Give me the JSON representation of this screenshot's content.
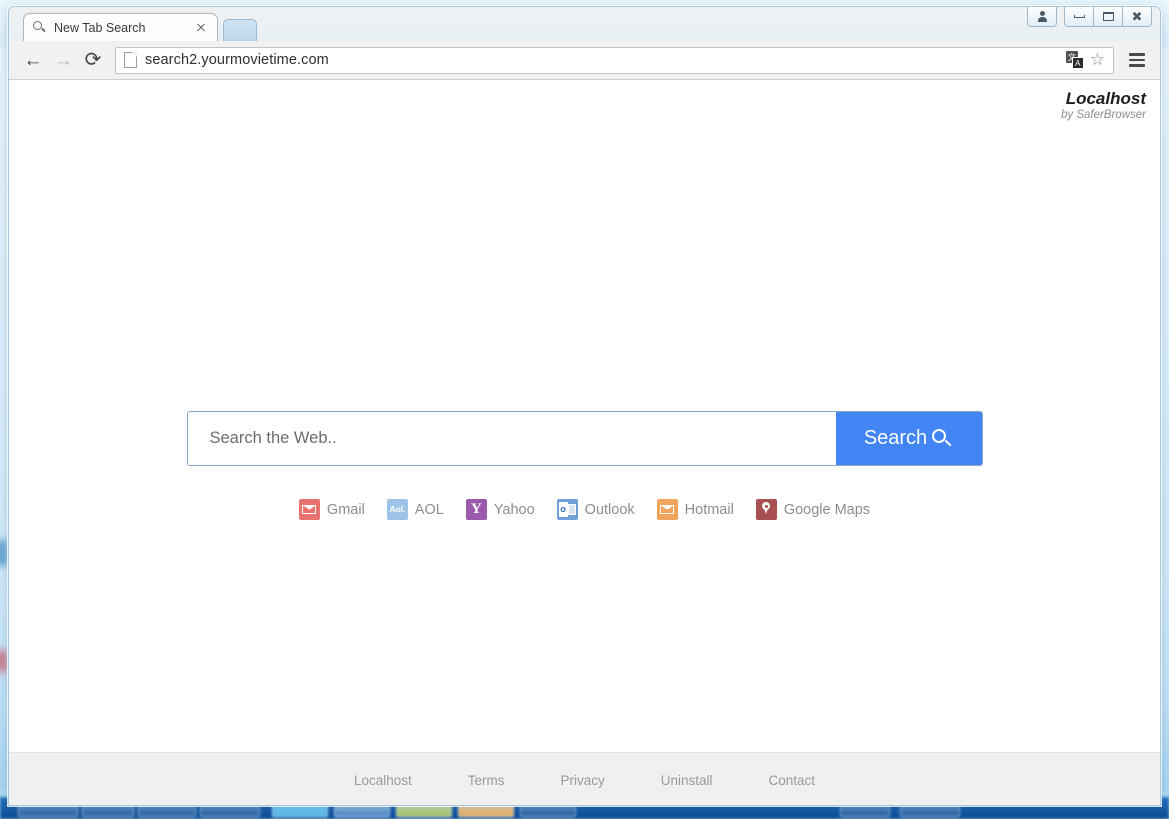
{
  "window": {
    "controls": [
      {
        "name": "user-switch",
        "glyph": "♟"
      },
      {
        "name": "minimize",
        "glyph": ""
      },
      {
        "name": "maximize",
        "glyph": ""
      },
      {
        "name": "close",
        "glyph": "✕"
      }
    ]
  },
  "tab": {
    "title": "New Tab Search",
    "favicon": "search-icon",
    "close_glyph": "×"
  },
  "toolbar": {
    "back_glyph": "←",
    "forward_glyph": "→",
    "reload_glyph": "⟳",
    "url": "search2.yourmovietime.com",
    "translate_a": "文",
    "translate_b": "A",
    "bookmark_glyph": "☆"
  },
  "brand": {
    "name": "Localhost",
    "by": "by SaferBrowser"
  },
  "search": {
    "placeholder": "Search the Web..",
    "value": "",
    "button_label": "Search",
    "button_color": "#4285f4"
  },
  "shortcuts": [
    {
      "label": "Gmail",
      "icon": "gmail-icon",
      "color": "#e8736e"
    },
    {
      "label": "AOL",
      "icon": "aol-icon",
      "color": "#9dc3e6",
      "mark": "Aol."
    },
    {
      "label": "Yahoo",
      "icon": "yahoo-icon",
      "color": "#9b5aab",
      "mark": "Y"
    },
    {
      "label": "Outlook",
      "icon": "outlook-icon",
      "color": "#6f9fd8",
      "mark": "o"
    },
    {
      "label": "Hotmail",
      "icon": "hotmail-icon",
      "color": "#f0a45c"
    },
    {
      "label": "Google Maps",
      "icon": "google-maps-icon",
      "color": "#a84f52"
    }
  ],
  "footer": {
    "links": [
      "Localhost",
      "Terms",
      "Privacy",
      "Uninstall",
      "Contact"
    ]
  }
}
